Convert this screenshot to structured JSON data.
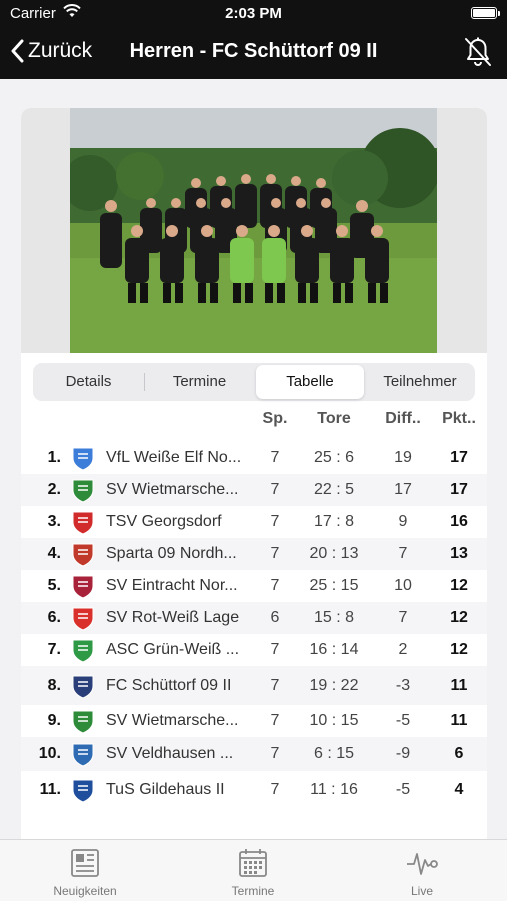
{
  "status": {
    "carrier": "Carrier",
    "time": "2:03 PM"
  },
  "nav": {
    "back_label": "Zurück",
    "title": "Herren - FC Schüttorf 09 II"
  },
  "segments": [
    "Details",
    "Termine",
    "Tabelle",
    "Teilnehmer"
  ],
  "active_segment": "Tabelle",
  "table": {
    "headers": {
      "sp": "Sp.",
      "tore": "Tore",
      "diff": "Diff..",
      "pkt": "Pkt.."
    },
    "rows": [
      {
        "rank": "1.",
        "team": "VfL Weiße Elf No...",
        "sp": "7",
        "tore": "25 : 6",
        "diff": "19",
        "pkt": "17",
        "logo": "vfl-weisse-elf-logo",
        "color": "#3b7dd8"
      },
      {
        "rank": "2.",
        "team": "SV Wietmarsche...",
        "sp": "7",
        "tore": "22 : 5",
        "diff": "17",
        "pkt": "17",
        "logo": "sv-wietmarschen-logo",
        "color": "#2e8b3a"
      },
      {
        "rank": "3.",
        "team": "TSV Georgsdorf",
        "sp": "7",
        "tore": "17 : 8",
        "diff": "9",
        "pkt": "16",
        "logo": "tsv-georgsdorf-logo",
        "color": "#d22b2b"
      },
      {
        "rank": "4.",
        "team": "Sparta 09 Nordh...",
        "sp": "7",
        "tore": "20 : 13",
        "diff": "7",
        "pkt": "13",
        "logo": "sparta-09-logo",
        "color": "#c0392b"
      },
      {
        "rank": "5.",
        "team": "SV Eintracht Nor...",
        "sp": "7",
        "tore": "25 : 15",
        "diff": "10",
        "pkt": "12",
        "logo": "sv-eintracht-logo",
        "color": "#a8233a"
      },
      {
        "rank": "6.",
        "team": "SV Rot-Weiß Lage",
        "sp": "6",
        "tore": "15 : 8",
        "diff": "7",
        "pkt": "12",
        "logo": "sv-rot-weiss-lage-logo",
        "color": "#d9302c"
      },
      {
        "rank": "7.",
        "team": "ASC Grün-Weiß ...",
        "sp": "7",
        "tore": "16 : 14",
        "diff": "2",
        "pkt": "12",
        "logo": "asc-gruen-weiss-logo",
        "color": "#2f9a45"
      },
      {
        "rank": "8.",
        "team": "FC Schüttorf 09 II",
        "sp": "7",
        "tore": "19 : 22",
        "diff": "-3",
        "pkt": "11",
        "logo": "fc-schuettorf-logo",
        "color": "#2a3f7a"
      },
      {
        "rank": "9.",
        "team": "SV Wietmarsche...",
        "sp": "7",
        "tore": "10 : 15",
        "diff": "-5",
        "pkt": "11",
        "logo": "sv-wietmarschen-logo",
        "color": "#2e8b3a"
      },
      {
        "rank": "10.",
        "team": "SV Veldhausen ...",
        "sp": "7",
        "tore": "6 : 15",
        "diff": "-9",
        "pkt": "6",
        "logo": "sv-veldhausen-logo",
        "color": "#2f6bb3"
      },
      {
        "rank": "11.",
        "team": "TuS Gildehaus II",
        "sp": "7",
        "tore": "11 : 16",
        "diff": "-5",
        "pkt": "4",
        "logo": "tus-gildehaus-logo",
        "color": "#1f4e9c"
      }
    ]
  },
  "tabbar": [
    {
      "label": "Neuigkeiten",
      "icon": "news-icon"
    },
    {
      "label": "Termine",
      "icon": "calendar-icon"
    },
    {
      "label": "Live",
      "icon": "pulse-icon"
    }
  ]
}
